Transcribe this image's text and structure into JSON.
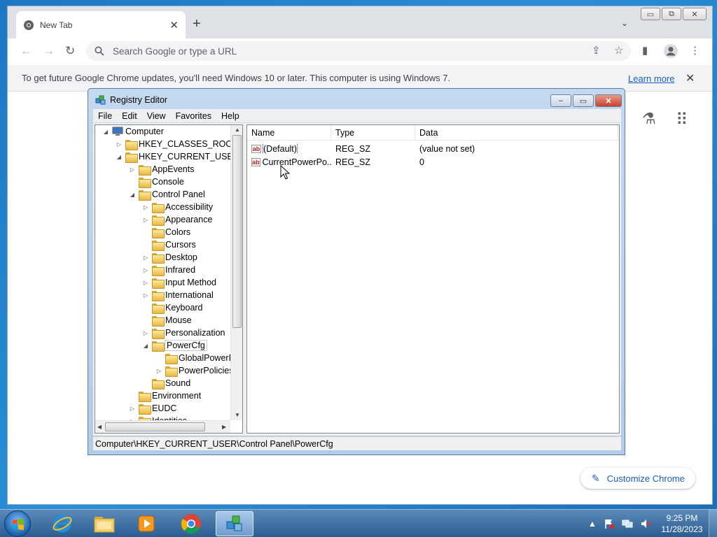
{
  "browser": {
    "tab_title": "New Tab",
    "tab_close": "✕",
    "new_tab": "+",
    "tab_menu": "⌄",
    "window_controls": {
      "minimize": "▭",
      "restore": "⧉",
      "close": "✕"
    },
    "nav": {
      "back": "←",
      "forward": "→",
      "reload": "↻"
    },
    "omnibox_placeholder": "Search Google or type a URL",
    "toolbar_icons": {
      "share": "⇪",
      "bookmark": "☆",
      "sidepanel": "▮",
      "menu": "⋮"
    },
    "infobar_text": "To get future Google Chrome updates, you'll need Windows 10 or later. This computer is using Windows 7.",
    "infobar_link": "Learn more",
    "infobar_close": "✕",
    "ntp_icons": {
      "labs": "⚗",
      "apps": "⠿"
    },
    "customize_label": "Customize Chrome",
    "customize_icon": "✎"
  },
  "regedit": {
    "title": "Registry Editor",
    "controls": {
      "minimize": "–",
      "maximize": "▭",
      "close": "✕"
    },
    "menu": [
      "File",
      "Edit",
      "View",
      "Favorites",
      "Help"
    ],
    "tree": [
      {
        "label": "Computer",
        "expander": "◢",
        "level": 0,
        "type": "computer"
      },
      {
        "label": "HKEY_CLASSES_ROOT",
        "expander": "▷",
        "level": 1
      },
      {
        "label": "HKEY_CURRENT_USER",
        "expander": "◢",
        "level": 1
      },
      {
        "label": "AppEvents",
        "expander": "▷",
        "level": 2
      },
      {
        "label": "Console",
        "expander": "",
        "level": 2
      },
      {
        "label": "Control Panel",
        "expander": "◢",
        "level": 2
      },
      {
        "label": "Accessibility",
        "expander": "▷",
        "level": 3
      },
      {
        "label": "Appearance",
        "expander": "▷",
        "level": 3
      },
      {
        "label": "Colors",
        "expander": "",
        "level": 3
      },
      {
        "label": "Cursors",
        "expander": "",
        "level": 3
      },
      {
        "label": "Desktop",
        "expander": "▷",
        "level": 3
      },
      {
        "label": "Infrared",
        "expander": "▷",
        "level": 3
      },
      {
        "label": "Input Method",
        "expander": "▷",
        "level": 3
      },
      {
        "label": "International",
        "expander": "▷",
        "level": 3
      },
      {
        "label": "Keyboard",
        "expander": "",
        "level": 3
      },
      {
        "label": "Mouse",
        "expander": "",
        "level": 3
      },
      {
        "label": "Personalization",
        "expander": "▷",
        "level": 3
      },
      {
        "label": "PowerCfg",
        "expander": "◢",
        "level": 3,
        "selected": true
      },
      {
        "label": "GlobalPowerP",
        "expander": "",
        "level": 4
      },
      {
        "label": "PowerPolicies",
        "expander": "▷",
        "level": 4
      },
      {
        "label": "Sound",
        "expander": "",
        "level": 3
      },
      {
        "label": "Environment",
        "expander": "",
        "level": 2
      },
      {
        "label": "EUDC",
        "expander": "▷",
        "level": 2
      },
      {
        "label": "Identities",
        "expander": "▷",
        "level": 2
      }
    ],
    "columns": [
      "Name",
      "Type",
      "Data"
    ],
    "values": [
      {
        "name": "(Default)",
        "type": "REG_SZ",
        "data": "(value not set)",
        "icon": "ab"
      },
      {
        "name": "CurrentPowerPo...",
        "type": "REG_SZ",
        "data": "0",
        "icon": "ab"
      }
    ],
    "status": "Computer\\HKEY_CURRENT_USER\\Control Panel\\PowerCfg"
  },
  "taskbar": {
    "apps": [
      "internet-explorer",
      "windows-explorer",
      "media-player",
      "chrome",
      "registry-editor"
    ],
    "tray_up": "▲",
    "time": "9:25 PM",
    "date": "11/28/2023"
  }
}
